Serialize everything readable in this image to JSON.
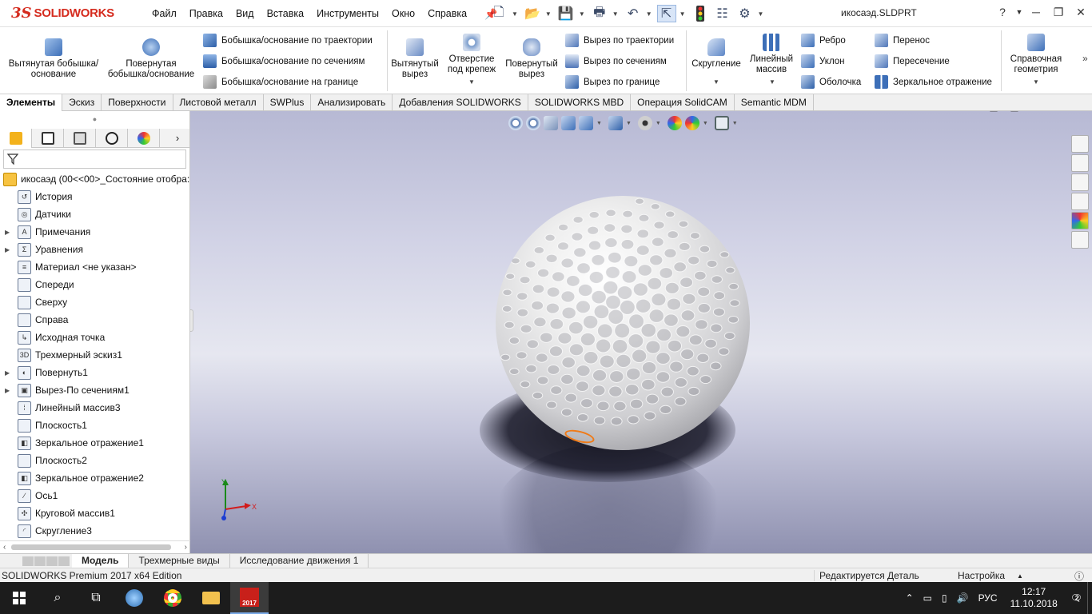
{
  "app": {
    "logo_ds": "3S",
    "logo_text": "SOLIDWORKS",
    "document_title": "икосаэд.SLDPRT"
  },
  "menu": [
    "Файл",
    "Правка",
    "Вид",
    "Вставка",
    "Инструменты",
    "Окно",
    "Справка"
  ],
  "ribbon": {
    "extruded_boss": "Вытянутая бобышка/основание",
    "revolved_boss": "Повернутая бобышка/основание",
    "swept_boss": "Бобышка/основание по траектории",
    "lofted_boss": "Бобышка/основание по сечениям",
    "boundary_boss": "Бобышка/основание на границе",
    "extruded_cut": "Вытянутый вырез",
    "hole_wizard": "Отверстие под крепеж",
    "revolved_cut": "Повернутый вырез",
    "swept_cut": "Вырез по траектории",
    "lofted_cut": "Вырез по сечениям",
    "boundary_cut": "Вырез по границе",
    "fillet": "Скругление",
    "linear_pattern": "Линейный массив",
    "rib": "Ребро",
    "draft": "Уклон",
    "shell": "Оболочка",
    "wrap": "Перенос",
    "intersect": "Пересечение",
    "mirror": "Зеркальное отражение",
    "reference_geometry": "Справочная геометрия"
  },
  "tabs": [
    "Элементы",
    "Эскиз",
    "Поверхности",
    "Листовой металл",
    "SWPlus",
    "Анализировать",
    "Добавления SOLIDWORKS",
    "SOLIDWORKS MBD",
    "Операция  SolidCAM",
    "Semantic MDM"
  ],
  "tree": {
    "root": "икосаэд  (00<<00>_Состояние отобра:",
    "items": [
      {
        "label": "История",
        "icon": "history-icon",
        "glyph": "↺"
      },
      {
        "label": "Датчики",
        "icon": "sensor-icon",
        "glyph": "◎"
      },
      {
        "label": "Примечания",
        "icon": "annotation-icon",
        "glyph": "A"
      },
      {
        "label": "Уравнения",
        "icon": "equation-icon",
        "glyph": "Σ"
      },
      {
        "label": "Материал <не указан>",
        "icon": "material-icon",
        "glyph": "≡"
      },
      {
        "label": "Спереди",
        "icon": "plane-icon",
        "glyph": ""
      },
      {
        "label": "Сверху",
        "icon": "plane-icon",
        "glyph": ""
      },
      {
        "label": "Справа",
        "icon": "plane-icon",
        "glyph": ""
      },
      {
        "label": "Исходная точка",
        "icon": "origin-icon",
        "glyph": "↳"
      },
      {
        "label": "Трехмерный эскиз1",
        "icon": "sketch3d-icon",
        "glyph": "3D"
      },
      {
        "label": "Повернуть1",
        "icon": "revolve-icon",
        "glyph": "◐"
      },
      {
        "label": "Вырез-По сечениям1",
        "icon": "loft-cut-icon",
        "glyph": "▣"
      },
      {
        "label": "Линейный массив3",
        "icon": "linear-pattern-icon",
        "glyph": "⁞"
      },
      {
        "label": "Плоскость1",
        "icon": "plane-icon",
        "glyph": ""
      },
      {
        "label": "Зеркальное отражение1",
        "icon": "mirror-icon",
        "glyph": "◧"
      },
      {
        "label": "Плоскость2",
        "icon": "plane-icon",
        "glyph": ""
      },
      {
        "label": "Зеркальное отражение2",
        "icon": "mirror-icon",
        "glyph": "◧"
      },
      {
        "label": "Ось1",
        "icon": "axis-icon",
        "glyph": "∕"
      },
      {
        "label": "Круговой массив1",
        "icon": "circular-pattern-icon",
        "glyph": "✣"
      },
      {
        "label": "Скругление3",
        "icon": "fillet-icon",
        "glyph": "◜"
      }
    ]
  },
  "bottom_tabs": [
    "Модель",
    "Трехмерные виды",
    "Исследование движения 1"
  ],
  "status": {
    "edition": "SOLIDWORKS Premium 2017 x64 Edition",
    "editing": "Редактируется Деталь",
    "settings": "Настройка"
  },
  "triad": {
    "x": "X",
    "y": "Y"
  },
  "taskbar": {
    "lang": "РУС",
    "time": "12:17",
    "date": "11.10.2018",
    "notifications": "2",
    "sw_label": "2017"
  },
  "colors": {
    "brand_red": "#d52b1e",
    "selection_orange": "#f07a16",
    "icon_blue": "#3d6fb8"
  }
}
